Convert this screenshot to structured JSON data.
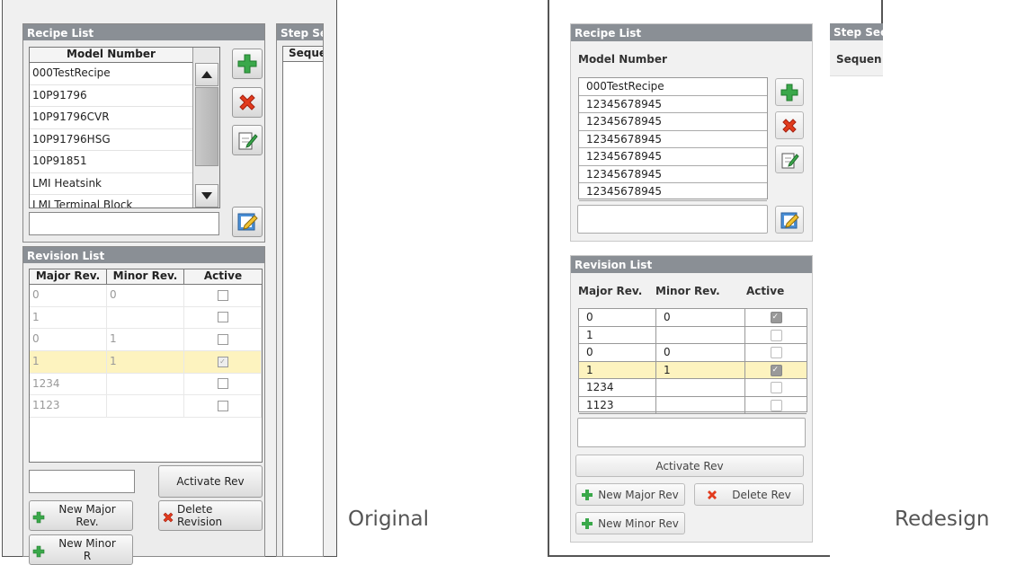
{
  "captions": {
    "original": "Original",
    "redesign": "Redesign"
  },
  "original": {
    "recipe_panel": {
      "title": "Recipe List",
      "column_header": "Model Number",
      "items": [
        "000TestRecipe",
        "10P91796",
        "10P91796CVR",
        "10P91796HSG",
        "10P91851",
        "LMI Heatsink",
        "LMI Terminal Block"
      ]
    },
    "step_panel": {
      "title": "Step Se",
      "column_header": "Seque"
    },
    "revision_panel": {
      "title": "Revision List",
      "headers": {
        "major": "Major Rev.",
        "minor": "Minor Rev.",
        "active": "Active"
      },
      "rows": [
        {
          "major": "0",
          "minor": "0",
          "active": false
        },
        {
          "major": "1",
          "minor": "",
          "active": false
        },
        {
          "major": "0",
          "minor": "1",
          "active": false
        },
        {
          "major": "1",
          "minor": "1",
          "active": true,
          "highlight": true
        },
        {
          "major": "1234",
          "minor": "",
          "active": false
        },
        {
          "major": "1123",
          "minor": "",
          "active": false
        }
      ],
      "buttons": {
        "activate": "Activate Rev",
        "new_major_1": "New Major",
        "new_major_2": "Rev.",
        "delete_1": "Delete",
        "delete_2": "Revision",
        "new_minor_1": "New Minor",
        "new_minor_2": "R"
      }
    }
  },
  "redesign": {
    "recipe_panel": {
      "title": "Recipe List",
      "label": "Model Number",
      "items": [
        "000TestRecipe",
        "12345678945",
        "12345678945",
        "12345678945",
        "12345678945",
        "12345678945",
        "12345678945"
      ]
    },
    "step_panel": {
      "title": "Step Sec",
      "column_header": "Sequen"
    },
    "revision_panel": {
      "title": "Revision List",
      "headers": {
        "major": "Major Rev.",
        "minor": "Minor Rev.",
        "active": "Active"
      },
      "rows": [
        {
          "major": "0",
          "minor": "0",
          "active": true
        },
        {
          "major": "1",
          "minor": "",
          "active": false
        },
        {
          "major": "0",
          "minor": "0",
          "active": false
        },
        {
          "major": "1",
          "minor": "1",
          "active": true,
          "highlight": true
        },
        {
          "major": "1234",
          "minor": "",
          "active": false
        },
        {
          "major": "1123",
          "minor": "",
          "active": false
        }
      ],
      "buttons": {
        "activate": "Activate Rev",
        "new_major": "New Major Rev",
        "delete": "Delete Rev",
        "new_minor": "New Minor Rev"
      }
    }
  },
  "colors": {
    "panel_title": "#8a8f95",
    "highlight": "#fdf3bf",
    "add_green": "#3aa84a",
    "delete_red": "#e23b1d"
  }
}
